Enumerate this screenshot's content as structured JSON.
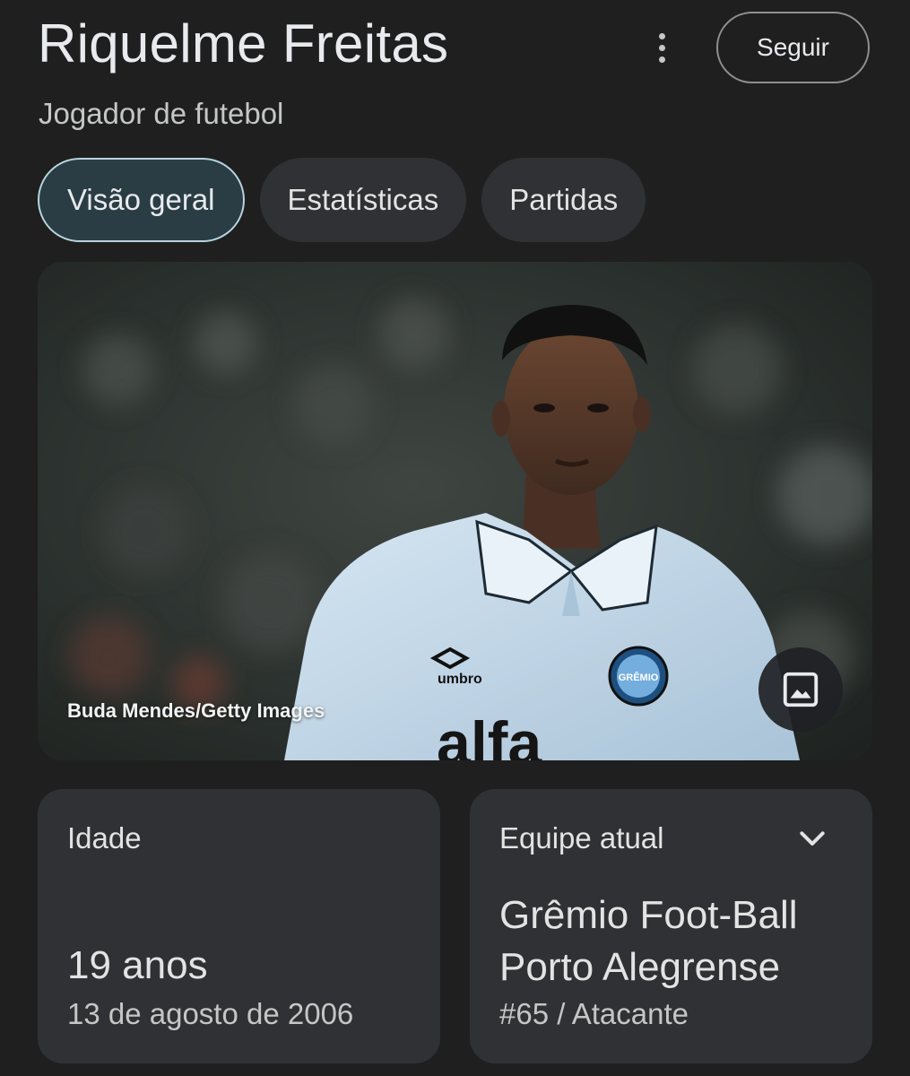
{
  "header": {
    "name": "Riquelme Freitas",
    "subtitle": "Jogador de futebol",
    "follow_label": "Seguir",
    "more_icon": "more-vert-icon"
  },
  "tabs": [
    {
      "label": "Visão geral",
      "active": true
    },
    {
      "label": "Estatísticas",
      "active": false
    },
    {
      "label": "Partidas",
      "active": false
    }
  ],
  "photo": {
    "credit": "Buda Mendes/Getty Images",
    "jersey_brand": "umbro",
    "jersey_crest": "GRÊMIO",
    "jersey_sponsor": "alfa",
    "image_icon": "image-icon"
  },
  "age_card": {
    "label": "Idade",
    "value": "19 anos",
    "birth_date": "13 de agosto de 2006"
  },
  "team_card": {
    "label": "Equipe atual",
    "team_line1": "Grêmio Foot-Ball",
    "team_line2": "Porto Alegrense",
    "role": "#65 / Atacante",
    "expand_icon": "chevron-down-icon"
  },
  "colors": {
    "background": "#1f1f1f",
    "card": "#303134",
    "active_tab_bg": "#2a3d45",
    "active_tab_border": "#b8d3dd"
  }
}
